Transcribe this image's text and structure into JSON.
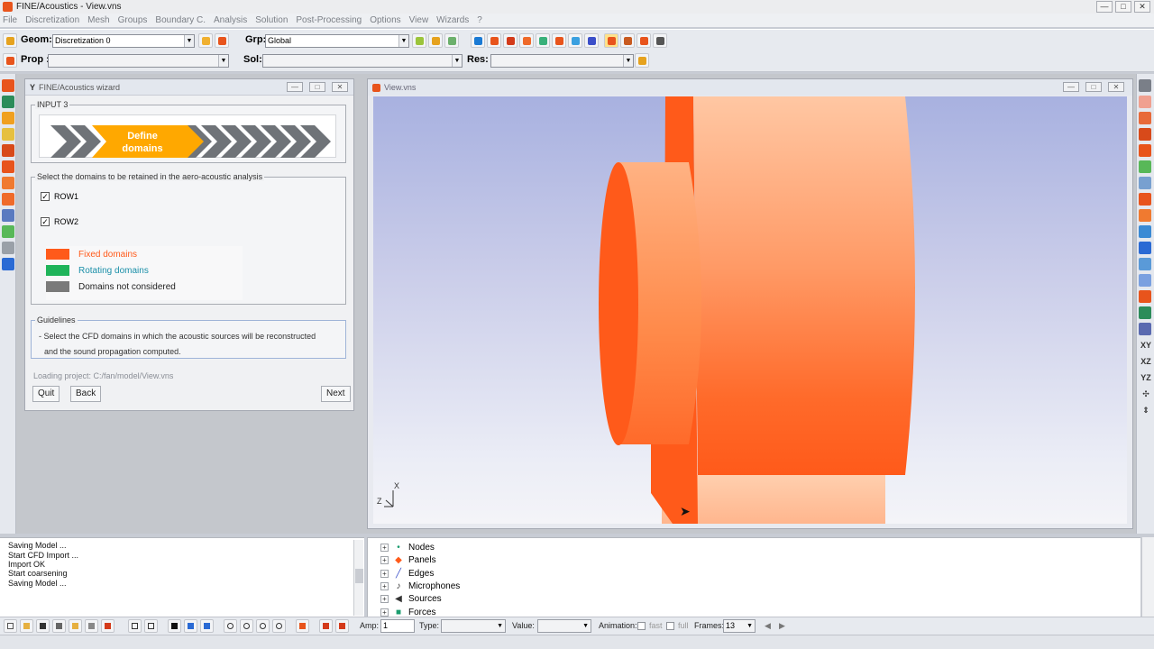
{
  "window": {
    "title": "FINE/Acoustics - View.vns",
    "min": "—",
    "max": "□",
    "close": "✕"
  },
  "menu": [
    "File",
    "Discretization",
    "Mesh",
    "Groups",
    "Boundary C.",
    "Analysis",
    "Solution",
    "Post-Processing",
    "Options",
    "View",
    "Wizards",
    "?"
  ],
  "toolbar": {
    "geom_label": "Geom:",
    "geom_value": "Discretization 0",
    "grp_label": "Grp:",
    "grp_value": "Global",
    "prop_label": "Prop :",
    "prop_value": "",
    "sol_label": "Sol:",
    "sol_value": "",
    "res_label": "Res:",
    "res_value": ""
  },
  "wizard": {
    "title": "FINE/Acoustics wizard",
    "step_group": "INPUT 3",
    "step_label_line1": "Define",
    "step_label_line2": "domains",
    "domains_group": "Select the domains to be retained in the aero-acoustic analysis",
    "rows": [
      {
        "label": "ROW1",
        "checked": true
      },
      {
        "label": "ROW2",
        "checked": true
      }
    ],
    "legend": [
      {
        "label": "Fixed domains",
        "color": "#ff5a1a",
        "text_color": "#ff5a1a"
      },
      {
        "label": "Rotating domains",
        "color": "#1fb45a",
        "text_color": "#1a8fa8"
      },
      {
        "label": "Domains not considered",
        "color": "#7a7a7a",
        "text_color": "#222222"
      }
    ],
    "guidelines_group": "Guidelines",
    "guidelines_line1": "- Select the CFD domains in which the acoustic sources will be reconstructed",
    "guidelines_line2": "and the sound propagation computed.",
    "status": "Loading project: C:/fan/model/View.vns",
    "buttons": {
      "quit": "Quit",
      "back": "Back",
      "next": "Next"
    }
  },
  "view": {
    "title": "View.vns",
    "axis_x": "X",
    "axis_z": "Z"
  },
  "console": [
    "Saving Model ...",
    "Start CFD Import ...",
    "Import OK",
    "Start coarsening",
    "Saving Model ..."
  ],
  "tree": [
    {
      "label": "Nodes",
      "icon": "•",
      "icon_color": "#1a9c6e"
    },
    {
      "label": "Panels",
      "icon": "◆",
      "icon_color": "#ff5a1a"
    },
    {
      "label": "Edges",
      "icon": "╱",
      "icon_color": "#3b4fc9"
    },
    {
      "label": "Microphones",
      "icon": "♪",
      "icon_color": "#333333"
    },
    {
      "label": "Sources",
      "icon": "◀",
      "icon_color": "#333333"
    },
    {
      "label": "Forces",
      "icon": "■",
      "icon_color": "#1a9c6e"
    }
  ],
  "bottom": {
    "amp_label": "Amp:",
    "amp_value": "1",
    "type_label": "Type:",
    "value_label": "Value:",
    "animation_label": "Animation:",
    "fast_label": "fast",
    "full_label": "full",
    "frames_label": "Frames:",
    "frames_value": "13"
  },
  "colors": {
    "fixed": "#ff5a1a",
    "accent_orange": "#ffa800",
    "chevron_gray": "#6f7378"
  }
}
